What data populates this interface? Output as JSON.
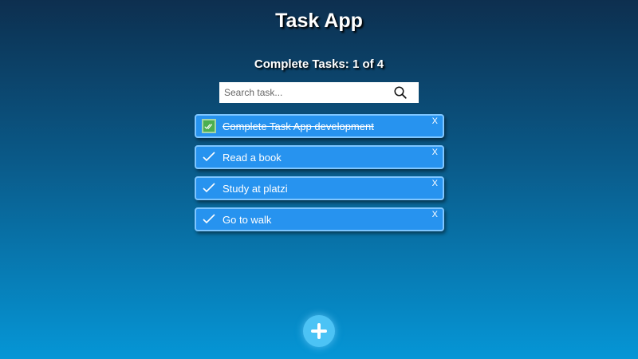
{
  "app": {
    "title": "Task App"
  },
  "counter": {
    "text": "Complete Tasks: 1 of 4"
  },
  "search": {
    "placeholder": "Search task...",
    "value": "",
    "icon": "search-icon"
  },
  "tasks": [
    {
      "text": "Complete Task App development",
      "completed": true,
      "delete_label": "X"
    },
    {
      "text": "Read a book",
      "completed": false,
      "delete_label": "X"
    },
    {
      "text": "Study at platzi",
      "completed": false,
      "delete_label": "X"
    },
    {
      "text": "Go to walk",
      "completed": false,
      "delete_label": "X"
    }
  ],
  "add_button": {
    "icon": "plus-icon"
  },
  "colors": {
    "background_top": "#0d2f4f",
    "background_bottom": "#0596d6",
    "task_background": "#2793ef",
    "task_border": "#7ec6ff",
    "completed_check": "#4caf50",
    "add_button": "#4cc3f5"
  }
}
